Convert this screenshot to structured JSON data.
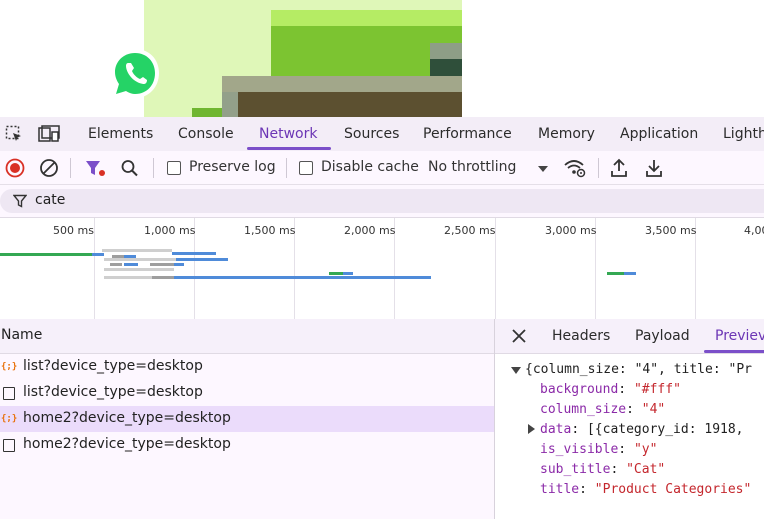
{
  "page_preview": {
    "colors": {
      "light_green": "#dff7b8",
      "lime": "#a8e060",
      "green": "#7cc431",
      "dark_green": "#2f4f3a",
      "grey_green": "#a2a78a",
      "olive": "#5c5030",
      "gray": "#93a08a",
      "bright_green": "#6fb630"
    },
    "whatsapp_icon": "whatsapp-icon"
  },
  "devtools": {
    "tabs": [
      {
        "label": "Elements"
      },
      {
        "label": "Console"
      },
      {
        "label": "Network"
      },
      {
        "label": "Sources"
      },
      {
        "label": "Performance"
      },
      {
        "label": "Memory"
      },
      {
        "label": "Application"
      },
      {
        "label": "Lighth"
      }
    ],
    "active_tab": "Network",
    "toolbar": {
      "preserve_log_label": "Preserve log",
      "disable_cache_label": "Disable cache",
      "throttling_value": "No throttling"
    },
    "filter": {
      "value": "cate"
    },
    "timeline": {
      "ticks": [
        "500 ms",
        "1,000 ms",
        "1,500 ms",
        "2,000 ms",
        "2,500 ms",
        "3,000 ms",
        "3,500 ms",
        "4,00"
      ]
    },
    "requests": {
      "header": "Name",
      "rows": [
        {
          "name": "list?device_type=desktop",
          "icon": "json-icon",
          "selected": false
        },
        {
          "name": "list?device_type=desktop",
          "icon": "document-icon",
          "selected": false
        },
        {
          "name": "home2?device_type=desktop",
          "icon": "json-icon",
          "selected": true
        },
        {
          "name": "home2?device_type=desktop",
          "icon": "document-icon",
          "selected": false
        }
      ]
    },
    "detail": {
      "tabs": [
        {
          "label": "Headers"
        },
        {
          "label": "Payload"
        },
        {
          "label": "Previev"
        }
      ],
      "active_tab": "Previev",
      "preview": {
        "summary": "{column_size: \"4\", title: \"Pr",
        "lines": [
          {
            "key": "background",
            "value": "\"#fff\""
          },
          {
            "key": "column_size",
            "value": "\"4\""
          },
          {
            "key": "data",
            "value": "[{category_id: 1918, ",
            "expandable": true
          },
          {
            "key": "is_visible",
            "value": "\"y\""
          },
          {
            "key": "sub_title",
            "value": "\"Cat\""
          },
          {
            "key": "title",
            "value": "\"Product Categories\""
          }
        ]
      }
    },
    "accent_color": "#7b4fc9"
  }
}
